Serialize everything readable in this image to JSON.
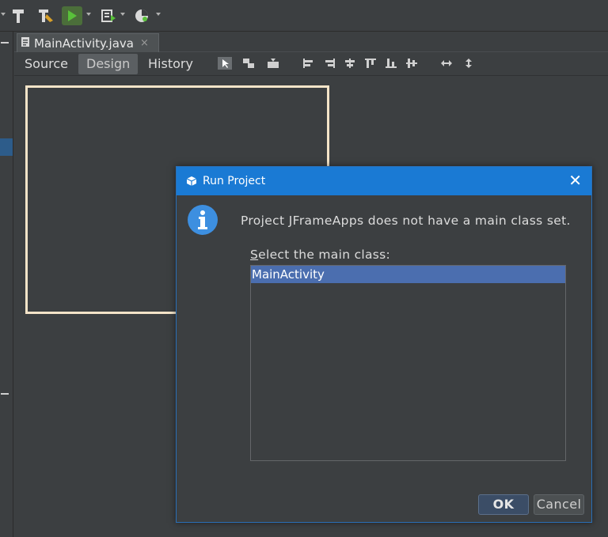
{
  "editor_tab": {
    "filename": "MainActivity.java",
    "close_symbol": "×"
  },
  "modes": {
    "source": "Source",
    "design": "Design",
    "history": "History"
  },
  "dialog": {
    "title": "Run Project",
    "close_symbol": "✕",
    "message": "Project JFrameApps does not have a main class set.",
    "select_label_first": "S",
    "select_label_rest": "elect the main class:",
    "classes": [
      "MainActivity"
    ],
    "ok_label": "OK",
    "cancel_label": "Cancel"
  },
  "colors": {
    "title_bar": "#1a7ad4",
    "selection": "#4b6eaf",
    "form_border": "#f4e4c8",
    "background": "#3c3f41",
    "info_icon": "#3d8fe0"
  },
  "icons": [
    "hammer-icon",
    "clean-build-icon",
    "run-icon",
    "debug-icon",
    "profile-icon",
    "java-file-icon",
    "info-icon",
    "dialog-app-icon"
  ]
}
